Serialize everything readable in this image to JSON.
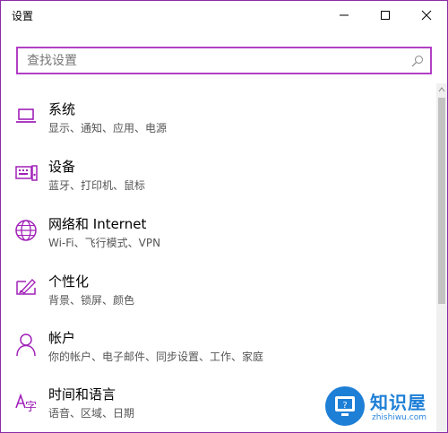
{
  "window": {
    "title": "设置",
    "border_color": "#8a2da8"
  },
  "search": {
    "placeholder": "查找设置",
    "value": ""
  },
  "accent_color": "#b23fc4",
  "items": [
    {
      "label": "系统",
      "desc": "显示、通知、应用、电源",
      "icon": "laptop-icon"
    },
    {
      "label": "设备",
      "desc": "蓝牙、打印机、鼠标",
      "icon": "keyboard-device-icon"
    },
    {
      "label": "网络和 Internet",
      "desc": "Wi-Fi、飞行模式、VPN",
      "icon": "globe-icon"
    },
    {
      "label": "个性化",
      "desc": "背景、锁屏、颜色",
      "icon": "paintbrush-monitor-icon"
    },
    {
      "label": "帐户",
      "desc": "你的帐户、电子邮件、同步设置、工作、家庭",
      "icon": "person-icon"
    },
    {
      "label": "时间和语言",
      "desc": "语音、区域、日期",
      "icon": "time-language-icon"
    }
  ],
  "watermark": {
    "title": "知识屋",
    "subtitle": "zhishiwu.com"
  }
}
